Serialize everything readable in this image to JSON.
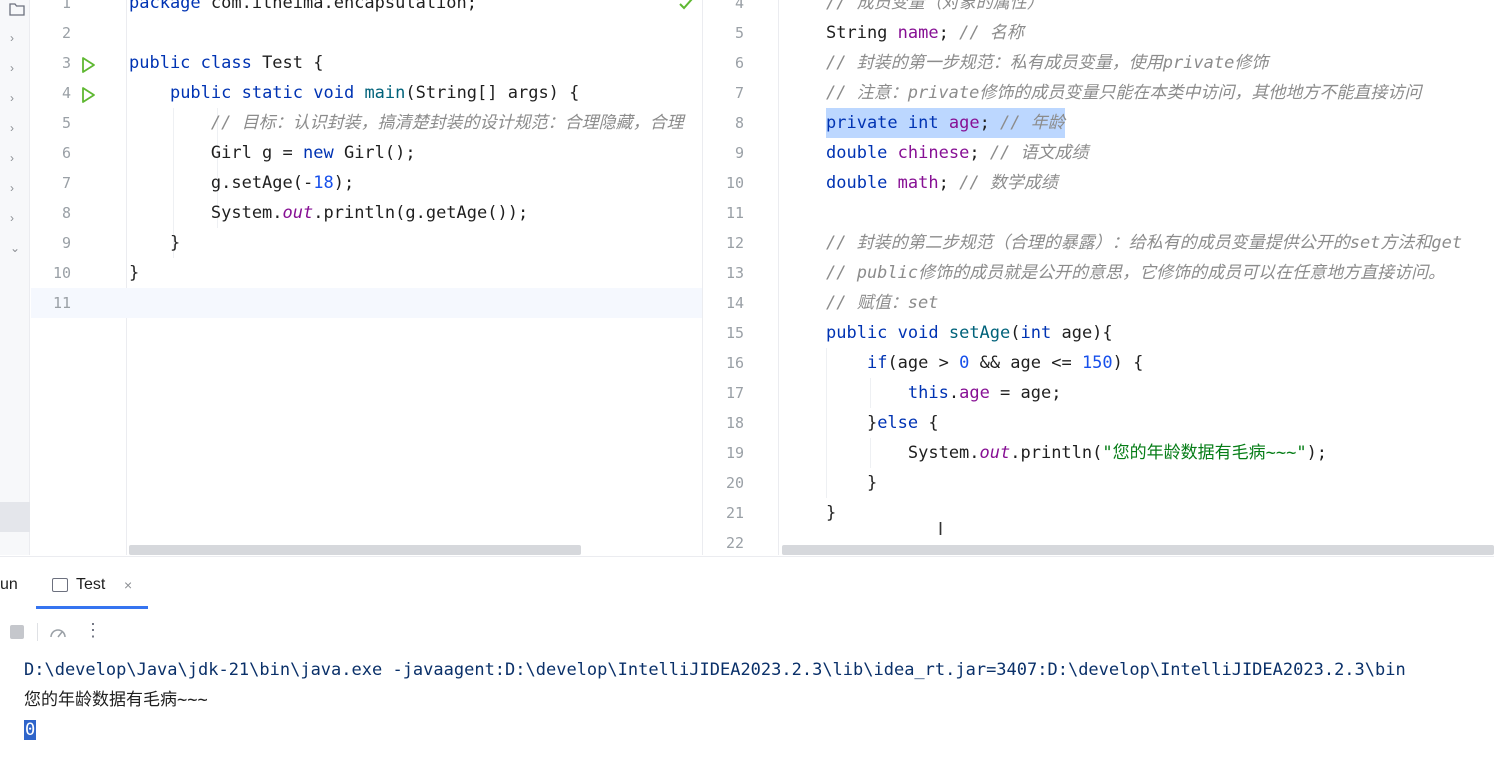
{
  "editor_left": {
    "file": "Test",
    "lines": [
      {
        "n": "1",
        "tokens": [
          [
            "kw",
            "package"
          ],
          [
            "cls",
            " com.itheima.encapsulation;"
          ]
        ]
      },
      {
        "n": "2",
        "tokens": []
      },
      {
        "n": "3",
        "tokens": [
          [
            "kw",
            "public class"
          ],
          [
            "cls",
            " Test {"
          ]
        ],
        "run": true
      },
      {
        "n": "4",
        "tokens": [
          [
            "cls",
            "    "
          ],
          [
            "kw",
            "public static void"
          ],
          [
            "cls",
            " "
          ],
          [
            "fn",
            "main"
          ],
          [
            "cls",
            "(String[] args) {"
          ]
        ],
        "run": true
      },
      {
        "n": "5",
        "tokens": [
          [
            "cls",
            "        "
          ],
          [
            "cmt",
            "// 目标：认识封装，搞清楚封装的设计规范：合理隐藏，合理"
          ]
        ]
      },
      {
        "n": "6",
        "tokens": [
          [
            "cls",
            "        Girl g = "
          ],
          [
            "kw",
            "new"
          ],
          [
            "cls",
            " Girl();"
          ]
        ]
      },
      {
        "n": "7",
        "tokens": [
          [
            "cls",
            "        g.setAge(-"
          ],
          [
            "num",
            "18"
          ],
          [
            "cls",
            ");"
          ]
        ]
      },
      {
        "n": "8",
        "tokens": [
          [
            "cls",
            "        System."
          ],
          [
            "static-fld",
            "out"
          ],
          [
            "cls",
            ".println(g.getAge());"
          ]
        ]
      },
      {
        "n": "9",
        "tokens": [
          [
            "cls",
            "    }"
          ]
        ]
      },
      {
        "n": "10",
        "tokens": [
          [
            "cls",
            "}"
          ]
        ]
      },
      {
        "n": "11",
        "tokens": [],
        "current": true
      }
    ]
  },
  "editor_right": {
    "lines": [
      {
        "n": "4",
        "tokens": [
          [
            "cmt",
            "// 成员变量（对象的属性）"
          ]
        ]
      },
      {
        "n": "5",
        "tokens": [
          [
            "cls",
            "String "
          ],
          [
            "fld",
            "name"
          ],
          [
            "cls",
            "; "
          ],
          [
            "cmt",
            "// 名称"
          ]
        ]
      },
      {
        "n": "6",
        "tokens": [
          [
            "cmt",
            "// 封装的第一步规范：私有成员变量，使用private修饰"
          ]
        ]
      },
      {
        "n": "7",
        "tokens": [
          [
            "cmt",
            "// 注意：private修饰的成员变量只能在本类中访问，其他地方不能直接访问"
          ]
        ]
      },
      {
        "n": "8",
        "tokens": [
          [
            "kw",
            "private int"
          ],
          [
            "cls",
            " "
          ],
          [
            "fld",
            "age"
          ],
          [
            "cls",
            "; "
          ],
          [
            "cmt",
            "// 年龄"
          ]
        ],
        "selected": true
      },
      {
        "n": "9",
        "tokens": [
          [
            "kw",
            "double"
          ],
          [
            "cls",
            " "
          ],
          [
            "fld",
            "chinese"
          ],
          [
            "cls",
            "; "
          ],
          [
            "cmt",
            "// 语文成绩"
          ]
        ]
      },
      {
        "n": "10",
        "tokens": [
          [
            "kw",
            "double"
          ],
          [
            "cls",
            " "
          ],
          [
            "fld",
            "math"
          ],
          [
            "cls",
            "; "
          ],
          [
            "cmt",
            "// 数学成绩"
          ]
        ]
      },
      {
        "n": "11",
        "tokens": []
      },
      {
        "n": "12",
        "tokens": [
          [
            "cmt",
            "// 封装的第二步规范（合理的暴露）：给私有的成员变量提供公开的set方法和get"
          ]
        ]
      },
      {
        "n": "13",
        "tokens": [
          [
            "cmt",
            "// public修饰的成员就是公开的意思，它修饰的成员可以在任意地方直接访问。"
          ]
        ]
      },
      {
        "n": "14",
        "tokens": [
          [
            "cmt",
            "// 赋值：set"
          ]
        ]
      },
      {
        "n": "15",
        "tokens": [
          [
            "kw",
            "public void"
          ],
          [
            "cls",
            " "
          ],
          [
            "fn",
            "setAge"
          ],
          [
            "cls",
            "("
          ],
          [
            "kw",
            "int"
          ],
          [
            "cls",
            " age){"
          ]
        ]
      },
      {
        "n": "16",
        "tokens": [
          [
            "cls",
            "    "
          ],
          [
            "kw",
            "if"
          ],
          [
            "cls",
            "(age > "
          ],
          [
            "num",
            "0"
          ],
          [
            "cls",
            " && age <= "
          ],
          [
            "num",
            "150"
          ],
          [
            "cls",
            ") {"
          ]
        ]
      },
      {
        "n": "17",
        "tokens": [
          [
            "cls",
            "        "
          ],
          [
            "kw",
            "this"
          ],
          [
            "cls",
            "."
          ],
          [
            "fld",
            "age"
          ],
          [
            "cls",
            " = age;"
          ]
        ]
      },
      {
        "n": "18",
        "tokens": [
          [
            "cls",
            "    }"
          ],
          [
            "kw",
            "else"
          ],
          [
            "cls",
            " {"
          ]
        ]
      },
      {
        "n": "19",
        "tokens": [
          [
            "cls",
            "        System."
          ],
          [
            "static-fld",
            "out"
          ],
          [
            "cls",
            ".println("
          ],
          [
            "str",
            "\"您的年龄数据有毛病~~~\""
          ],
          [
            "cls",
            ");"
          ]
        ]
      },
      {
        "n": "20",
        "tokens": [
          [
            "cls",
            "    }"
          ]
        ]
      },
      {
        "n": "21",
        "tokens": [
          [
            "cls",
            "}"
          ]
        ]
      },
      {
        "n": "22",
        "tokens": []
      }
    ]
  },
  "run_panel": {
    "title": "un",
    "tab_label": "Test",
    "tab_close": "×",
    "more": "⋮",
    "console": {
      "command": "D:\\develop\\Java\\jdk-21\\bin\\java.exe -javaagent:D:\\develop\\IntelliJIDEA2023.2.3\\lib\\idea_rt.jar=3407:D:\\develop\\IntelliJIDEA2023.2.3\\bin",
      "output_line": "您的年龄数据有毛病~~~",
      "result": "0"
    }
  },
  "colors": {
    "keyword": "#0033b3",
    "field": "#871094",
    "number": "#1750eb",
    "string": "#067d17",
    "comment": "#8c8c8c",
    "accent": "#3574f0",
    "run_icon": "#5fb832"
  }
}
